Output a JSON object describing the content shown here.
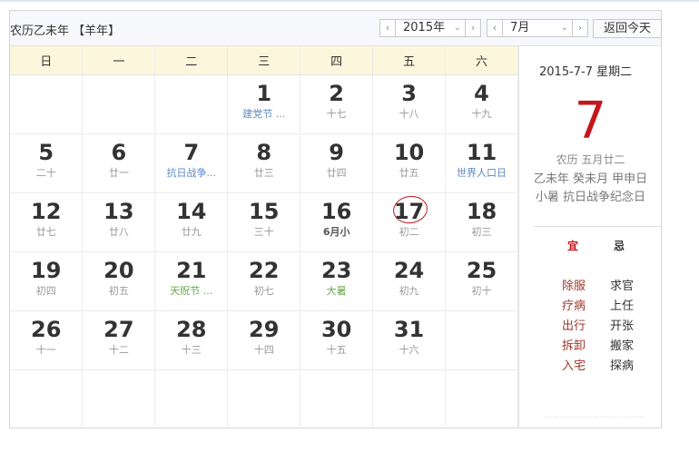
{
  "header": {
    "lunar_title": "农历乙未年 【羊年】",
    "year_value": "2015年",
    "month_value": "7月",
    "today_button": "返回今天",
    "prev_arrow": "‹",
    "next_arrow": "›",
    "dropdown_arrow": "⌄"
  },
  "weekdays": [
    "日",
    "一",
    "二",
    "三",
    "四",
    "五",
    "六"
  ],
  "weeks": [
    [
      {
        "day": "",
        "sub": "",
        "style": ""
      },
      {
        "day": "",
        "sub": "",
        "style": ""
      },
      {
        "day": "",
        "sub": "",
        "style": ""
      },
      {
        "day": "1",
        "sub": "建党节 ...",
        "style": "blue"
      },
      {
        "day": "2",
        "sub": "十七",
        "style": ""
      },
      {
        "day": "3",
        "sub": "十八",
        "style": ""
      },
      {
        "day": "4",
        "sub": "十九",
        "style": ""
      }
    ],
    [
      {
        "day": "5",
        "sub": "二十",
        "style": ""
      },
      {
        "day": "6",
        "sub": "廿一",
        "style": ""
      },
      {
        "day": "7",
        "sub": "抗日战争...",
        "style": "blue"
      },
      {
        "day": "8",
        "sub": "廿三",
        "style": ""
      },
      {
        "day": "9",
        "sub": "廿四",
        "style": ""
      },
      {
        "day": "10",
        "sub": "廿五",
        "style": ""
      },
      {
        "day": "11",
        "sub": "世界人口日",
        "style": "blue"
      }
    ],
    [
      {
        "day": "12",
        "sub": "廿七",
        "style": ""
      },
      {
        "day": "13",
        "sub": "廿八",
        "style": ""
      },
      {
        "day": "14",
        "sub": "廿九",
        "style": ""
      },
      {
        "day": "15",
        "sub": "三十",
        "style": ""
      },
      {
        "day": "16",
        "sub": "6月小",
        "style": "bold"
      },
      {
        "day": "17",
        "sub": "初二",
        "style": "",
        "circled": true
      },
      {
        "day": "18",
        "sub": "初三",
        "style": ""
      }
    ],
    [
      {
        "day": "19",
        "sub": "初四",
        "style": ""
      },
      {
        "day": "20",
        "sub": "初五",
        "style": ""
      },
      {
        "day": "21",
        "sub": "天贶节 ...",
        "style": "green"
      },
      {
        "day": "22",
        "sub": "初七",
        "style": ""
      },
      {
        "day": "23",
        "sub": "大暑",
        "style": "green"
      },
      {
        "day": "24",
        "sub": "初九",
        "style": ""
      },
      {
        "day": "25",
        "sub": "初十",
        "style": ""
      }
    ],
    [
      {
        "day": "26",
        "sub": "十一",
        "style": ""
      },
      {
        "day": "27",
        "sub": "十二",
        "style": ""
      },
      {
        "day": "28",
        "sub": "十三",
        "style": ""
      },
      {
        "day": "29",
        "sub": "十四",
        "style": ""
      },
      {
        "day": "30",
        "sub": "十五",
        "style": ""
      },
      {
        "day": "31",
        "sub": "十六",
        "style": ""
      },
      {
        "day": "",
        "sub": "",
        "style": ""
      }
    ],
    [
      {
        "day": "",
        "sub": "",
        "style": ""
      },
      {
        "day": "",
        "sub": "",
        "style": ""
      },
      {
        "day": "",
        "sub": "",
        "style": ""
      },
      {
        "day": "",
        "sub": "",
        "style": ""
      },
      {
        "day": "",
        "sub": "",
        "style": ""
      },
      {
        "day": "",
        "sub": "",
        "style": ""
      },
      {
        "day": "",
        "sub": "",
        "style": ""
      }
    ]
  ],
  "side": {
    "date_line": "2015-7-7  星期二",
    "big_day": "7",
    "lunar_date": "农历 五月廿二",
    "ganzhi": "乙未年 癸未月 甲申日",
    "festivals": "小暑 抗日战争纪念日",
    "yi_label": "宜",
    "ji_label": "忌",
    "yi_items": [
      "除服",
      "疗病",
      "出行",
      "拆卸",
      "入宅"
    ],
    "ji_items": [
      "求官",
      "上任",
      "开张",
      "搬家",
      "探病"
    ]
  },
  "colors": {
    "accent_red": "#c4161c",
    "weekday_header_bg": "#fcf6dd",
    "festival_blue": "#5b8ac4",
    "solar_term_green": "#6aa84f"
  }
}
